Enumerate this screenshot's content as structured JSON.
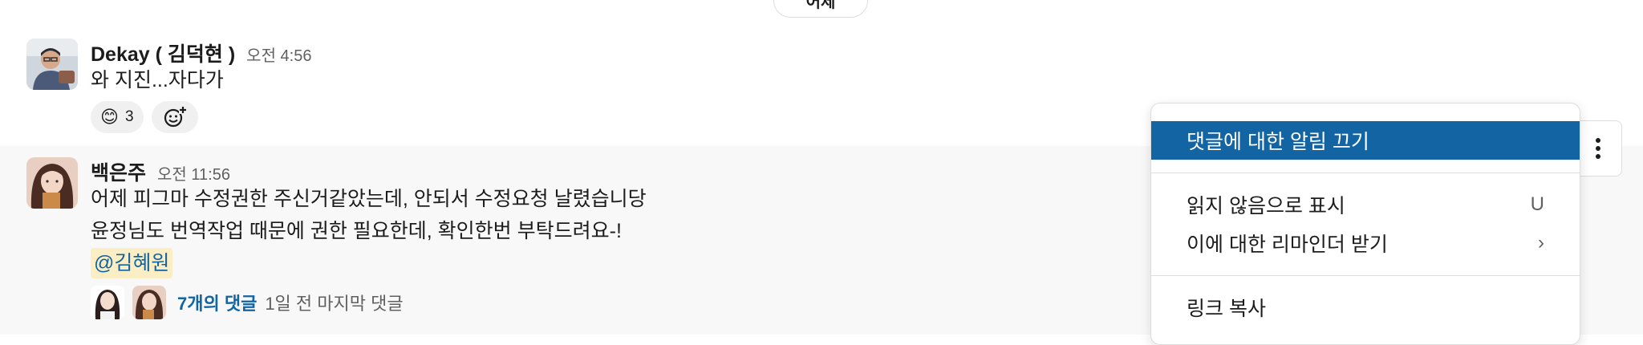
{
  "date_pill": {
    "label": "어제"
  },
  "messages": [
    {
      "author": "Dekay ( 김덕현 )",
      "time": "오전 4:56",
      "text_lines": [
        "와 지진...자다가"
      ],
      "reactions": [
        {
          "emoji": "😊",
          "count": "3"
        }
      ]
    },
    {
      "author": "백은주",
      "time": "오전 11:56",
      "text_lines": [
        "어제 피그마 수정권한 주신거같았는데, 안되서 수정요청 날렸습니당",
        "윤정님도 번역작업 때문에 권한 필요한데, 확인한번 부탁드려요-!"
      ],
      "mention": "@김혜원",
      "thread": {
        "count_label": "7개의 댓글",
        "last_reply": "1일 전 마지막 댓글"
      }
    }
  ],
  "context_menu": {
    "items": [
      {
        "label": "댓글에 대한 알림 끄기",
        "shortcut": ""
      },
      {
        "label": "읽지 않음으로 표시",
        "shortcut": "U"
      },
      {
        "label": "이에 대한 리마인더 받기",
        "shortcut": "›"
      },
      {
        "label": "링크 복사",
        "shortcut": ""
      }
    ]
  },
  "colors": {
    "accent": "#1264a3",
    "mention_bg": "#fbeec4",
    "hover_row": "#f8f8f8"
  }
}
